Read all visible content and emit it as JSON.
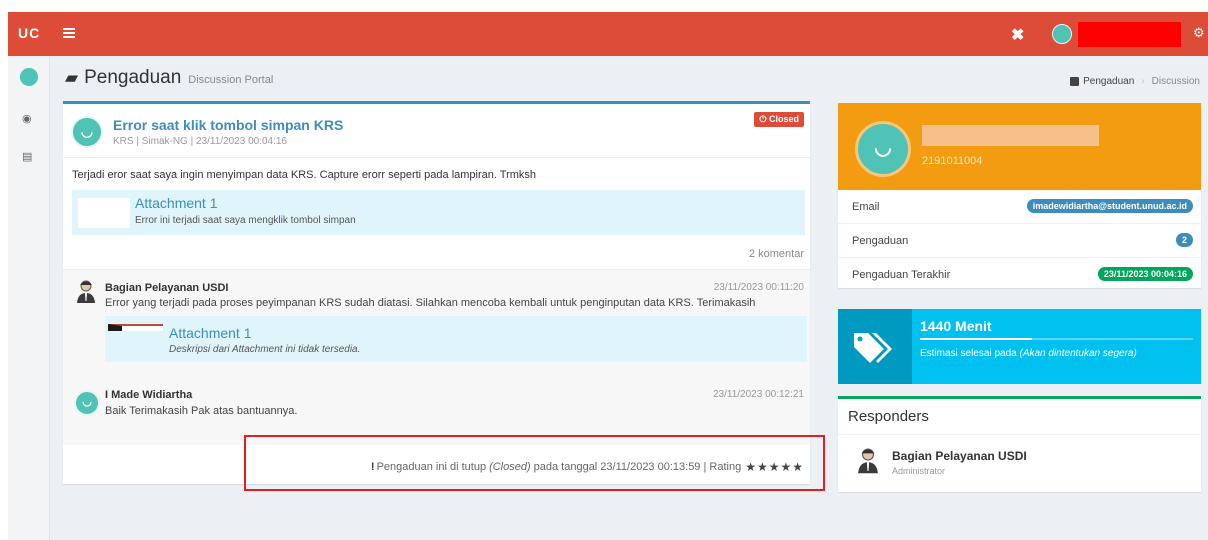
{
  "topbar": {
    "brand": "UC",
    "tools_icon": "✖",
    "gears_icon": "⚙"
  },
  "page": {
    "title": "Pengaduan",
    "subtitle": "Discussion Portal"
  },
  "breadcrumb": {
    "items": [
      "Pengaduan",
      "Discussion"
    ]
  },
  "question": {
    "avatar_face": "◡",
    "title": "Error saat klik tombol simpan KRS",
    "meta": "KRS | Simak-NG | 23/11/2023 00:04:16",
    "status": "Closed",
    "body": "Terjadi eror saat saya ingin menyimpan data KRS. Capture erorr seperti pada lampiran. Trmksh",
    "attachment": {
      "title": "Attachment 1",
      "description": "Error ini terjadi saat saya mengklik tombol simpan"
    },
    "comment_count": "2 komentar"
  },
  "comments": [
    {
      "name": "Bagian Pelayanan USDI",
      "time": "23/11/2023 00:11:20",
      "text": "Error yang terjadi pada proses peyimpanan KRS sudah diatasi. Silahkan mencoba kembali untuk penginputan data KRS. Terimakasih",
      "attachment": {
        "title": "Attachment 1",
        "description": "Deskripsi dari Attachment ini tidak tersedia."
      }
    },
    {
      "avatar_face": "◡",
      "name": "I Made Widiartha",
      "time": "23/11/2023 00:12:21",
      "text": "Baik Terimakasih Pak atas bantuannya."
    }
  ],
  "closed_note": {
    "icon": "!",
    "prefix": "Pengaduan ini di tutup",
    "closed_word": "(Closed)",
    "suffix": "pada tanggal 23/11/2023 00:13:59 | Rating",
    "stars": "★★★★★",
    "rating": 5
  },
  "profile": {
    "avatar_face": "◡",
    "student_id": "2191011004",
    "email_label": "Email",
    "email_value": "imadewidiartha@student.unud.ac.id",
    "pengaduan_label": "Pengaduan",
    "pengaduan_value": "2",
    "last_label": "Pengaduan Terakhir",
    "last_value": "23/11/2023 00:04:16"
  },
  "estimate": {
    "value": "1440 Menit",
    "desc_prefix": "Estimasi selesai pada",
    "desc_italic": "(Akan dintentukan segera)",
    "progress_fraction": 0.41
  },
  "responders": {
    "title": "Responders",
    "name": "Bagian Pelayanan USDI",
    "role": "Administrator"
  },
  "colors": {
    "topbar": "#dd4b39",
    "primary": "#3c8dbc",
    "orange": "#f39c12",
    "aqua": "#00c0ef",
    "green": "#00a65a",
    "redacted": "#ff0000"
  }
}
